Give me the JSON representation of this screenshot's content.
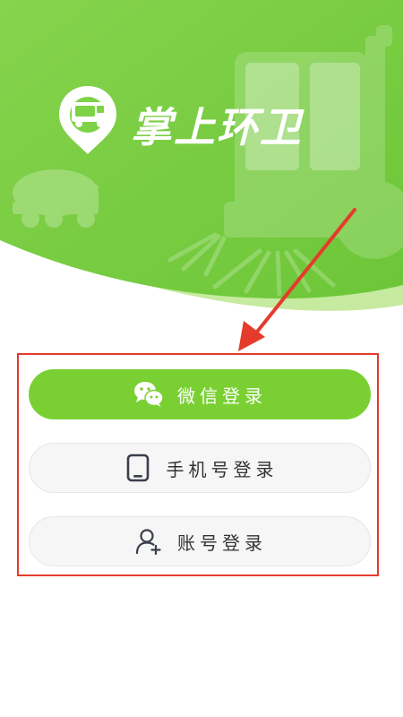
{
  "app": {
    "title": "掌上环卫"
  },
  "login": {
    "wechat_label": "微信登录",
    "phone_label": "手机号登录",
    "account_label": "账号登录"
  },
  "icons": {
    "logo": "location-pin-truck-icon",
    "wechat": "wechat-icon",
    "phone": "phone-icon",
    "account": "add-user-icon"
  },
  "colors": {
    "brand_green": "#7ad033",
    "header_green": "#7dd345",
    "highlight_red": "#e43b2c"
  }
}
